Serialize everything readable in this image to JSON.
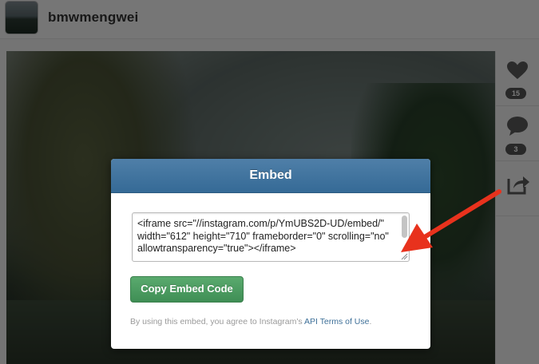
{
  "header": {
    "username": "bmwmengwei"
  },
  "sidebar": {
    "like": {
      "icon": "heart-icon",
      "count": "15"
    },
    "comment": {
      "icon": "comment-bubble-icon",
      "count": "3"
    },
    "share": {
      "icon": "share-icon"
    }
  },
  "modal": {
    "title": "Embed",
    "embed_code": "<iframe src=\"//instagram.com/p/YmUBS2D-UD/embed/\" width=\"612\" height=\"710\" frameborder=\"0\" scrolling=\"no\" allowtransparency=\"true\"></iframe>",
    "copy_button": "Copy Embed Code",
    "terms_prefix": "By using this embed, you agree to Instagram's ",
    "terms_link": "API Terms of Use",
    "terms_suffix": "."
  },
  "colors": {
    "modal_header": "#3d729e",
    "copy_button": "#4a9a5f",
    "annotation_arrow": "#e8321d"
  }
}
